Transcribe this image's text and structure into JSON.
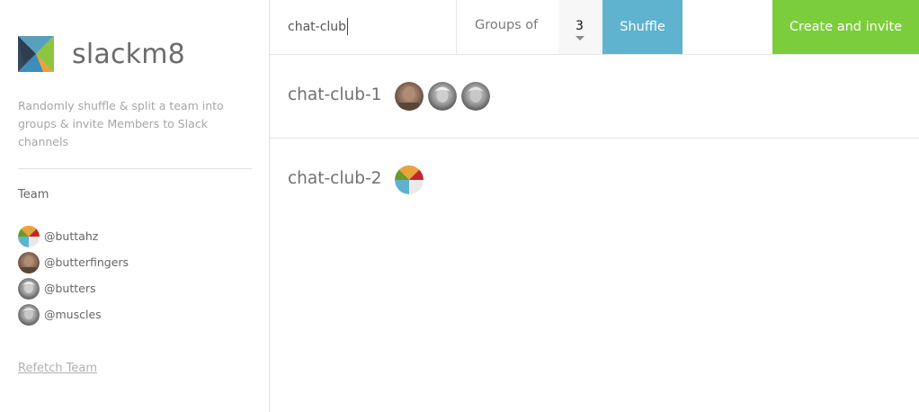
{
  "app": {
    "name": "slackm8",
    "logo_icon": "slackm8-logo-icon",
    "tagline": "Randomly shuffle & split a team into groups & invite Members to Slack channels"
  },
  "sidebar": {
    "team_heading": "Team",
    "members": [
      {
        "handle": "@buttahz",
        "avatar": "avatar-colorful-icon"
      },
      {
        "handle": "@butterfingers",
        "avatar": "avatar-photo-brown"
      },
      {
        "handle": "@butters",
        "avatar": "avatar-photo-gray"
      },
      {
        "handle": "@muscles",
        "avatar": "avatar-photo-gray"
      }
    ],
    "refetch_label": "Refetch Team"
  },
  "toolbar": {
    "group_name_value": "chat-club",
    "groups_of_label": "Groups of",
    "groups_of_value": "3",
    "shuffle_label": "Shuffle",
    "create_label": "Create and invite"
  },
  "groups": [
    {
      "name": "chat-club-1",
      "member_avatars": [
        "avatar-photo-brown",
        "avatar-photo-gray",
        "avatar-photo-gray"
      ]
    },
    {
      "name": "chat-club-2",
      "member_avatars": [
        "avatar-colorful-icon"
      ]
    }
  ],
  "colors": {
    "shuffle_button": "#5fb3cf",
    "create_button": "#7ccd3c",
    "muted_text": "#a6a6a6"
  }
}
